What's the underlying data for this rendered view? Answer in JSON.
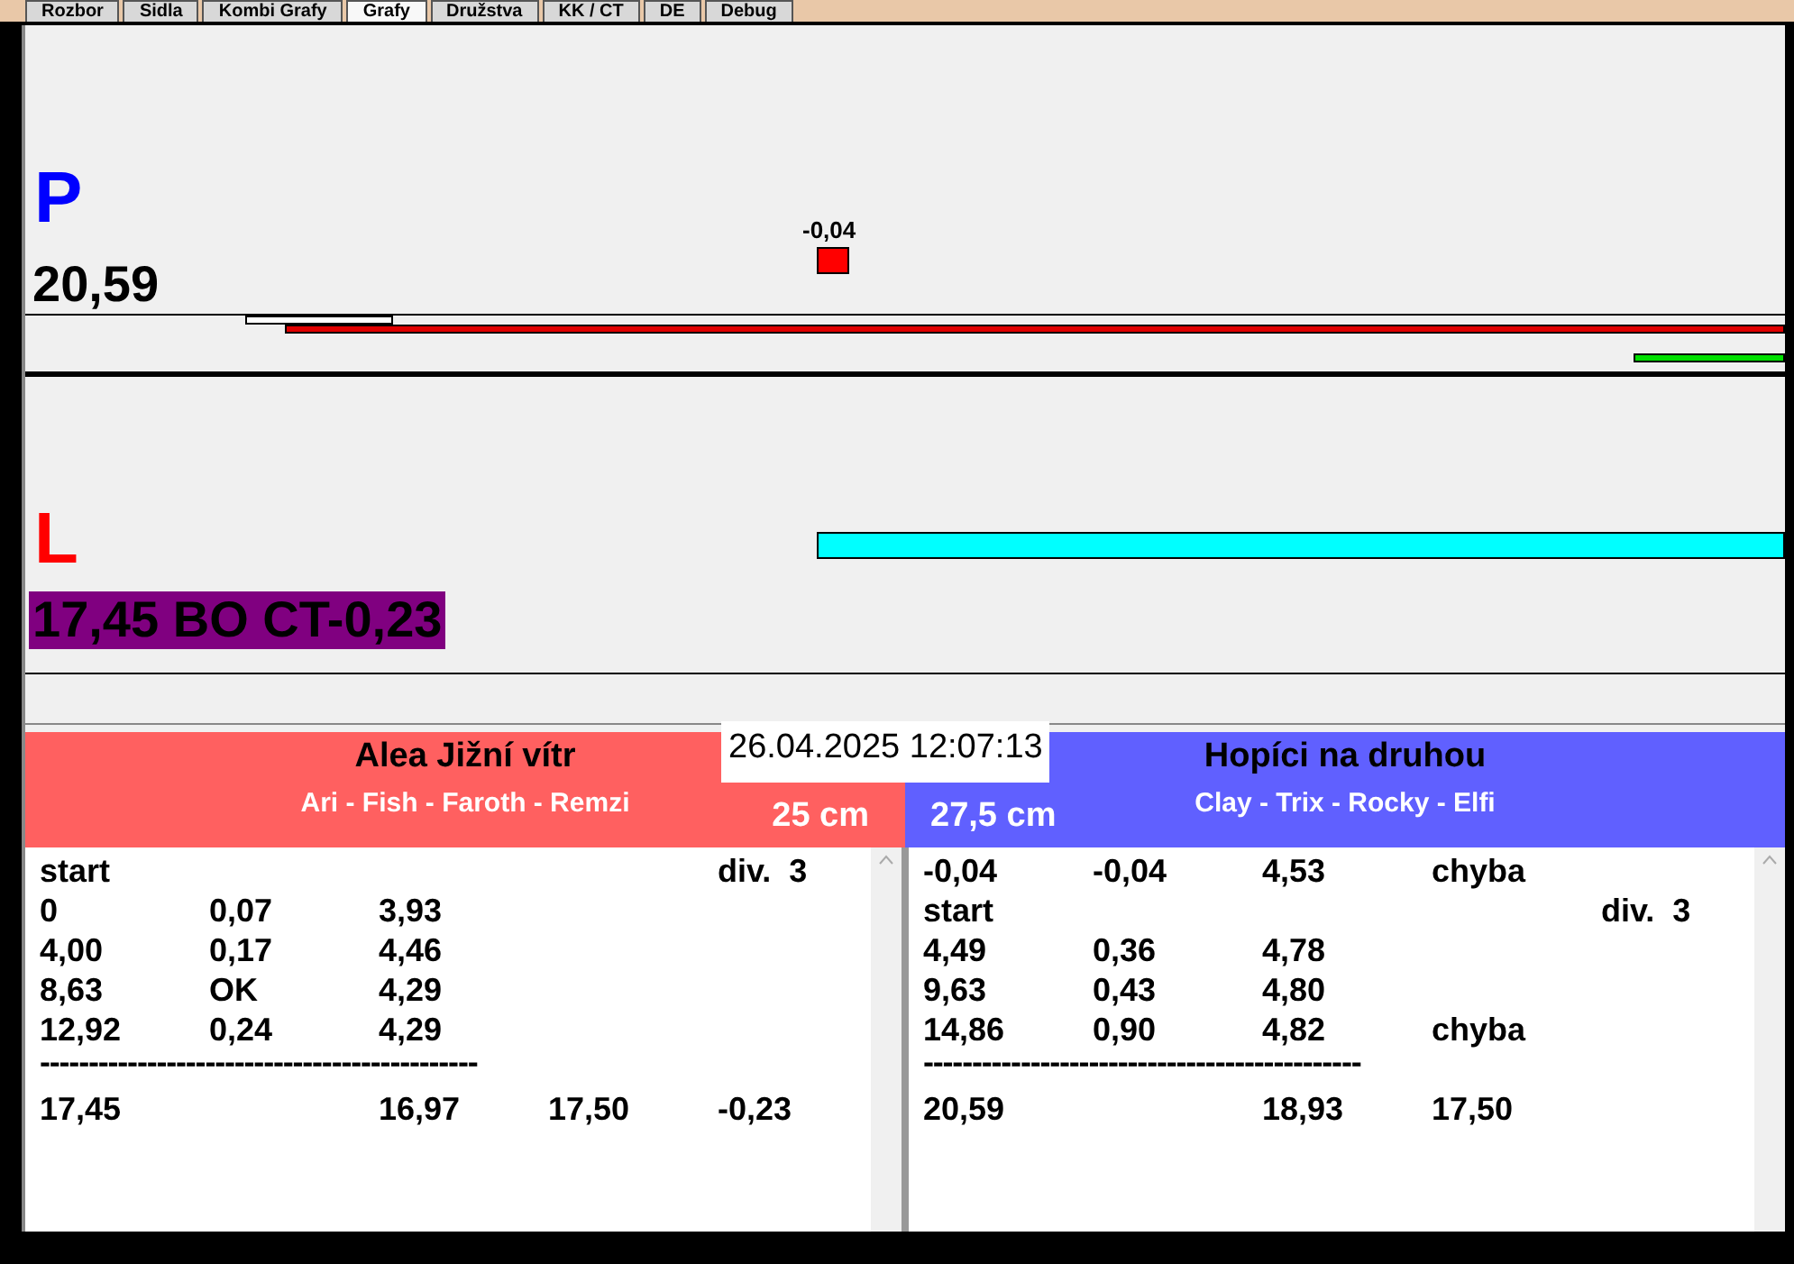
{
  "tabs": [
    {
      "label": "Rozbor",
      "selected": false
    },
    {
      "label": "Sidla",
      "selected": false
    },
    {
      "label": "Kombi Grafy",
      "selected": false
    },
    {
      "label": "Grafy",
      "selected": true
    },
    {
      "label": "Družstva",
      "selected": false
    },
    {
      "label": "KK / CT",
      "selected": false
    },
    {
      "label": "DE",
      "selected": false
    },
    {
      "label": "Debug",
      "selected": false
    }
  ],
  "tracks": [
    {
      "lane": "P",
      "color": "#0000ff",
      "score": "20,59",
      "score_highlight": false,
      "marker": "-0,04",
      "kind": "upper"
    },
    {
      "lane": "L",
      "color": "#ff0000",
      "score": "17,45 BO CT-0,23",
      "score_highlight": true,
      "kind": "lower"
    }
  ],
  "datetime": "26.04.2025 12:07:13",
  "teams": [
    {
      "name": "Alea Jižní vítr",
      "players": "Ari - Fish - Faroth - Remzi",
      "distance": "25 cm",
      "color": "#ff6060",
      "log": [
        {
          "kind": "row",
          "cells": [
            "start",
            null,
            null,
            null,
            "div.  3"
          ]
        },
        {
          "kind": "row",
          "cells": [
            "0",
            "0,07",
            "3,93",
            null,
            null
          ]
        },
        {
          "kind": "row",
          "cells": [
            "4,00",
            "0,17",
            "4,46",
            null,
            null
          ]
        },
        {
          "kind": "row",
          "cells": [
            "8,63",
            "OK",
            "4,29",
            null,
            null
          ]
        },
        {
          "kind": "row",
          "cells": [
            "12,92",
            "0,24",
            "4,29",
            null,
            null
          ]
        },
        {
          "kind": "separator",
          "text": "---------------------------------------------"
        },
        {
          "kind": "row",
          "cells": [
            "17,45",
            null,
            "16,97",
            "17,50",
            "-0,23"
          ]
        }
      ]
    },
    {
      "name": "Hopíci na druhou",
      "players": "Clay - Trix - Rocky - Elfi",
      "distance": "27,5 cm",
      "color": "#6060ff",
      "log": [
        {
          "kind": "row",
          "cells": [
            "-0,04",
            "-0,04",
            "4,53",
            "chyba",
            null
          ]
        },
        {
          "kind": "row",
          "cells": [
            "start",
            null,
            null,
            null,
            "div.  3"
          ]
        },
        {
          "kind": "row",
          "cells": [
            "4,49",
            "0,36",
            "4,78",
            null,
            null
          ]
        },
        {
          "kind": "row",
          "cells": [
            "9,63",
            "0,43",
            "4,80",
            null,
            null
          ]
        },
        {
          "kind": "row",
          "cells": [
            "14,86",
            "0,90",
            "4,82",
            "chyba",
            null
          ]
        },
        {
          "kind": "separator",
          "text": "---------------------------------------------"
        },
        {
          "kind": "row",
          "cells": [
            "20,59",
            null,
            "18,93",
            "17,50",
            null
          ]
        }
      ]
    }
  ]
}
